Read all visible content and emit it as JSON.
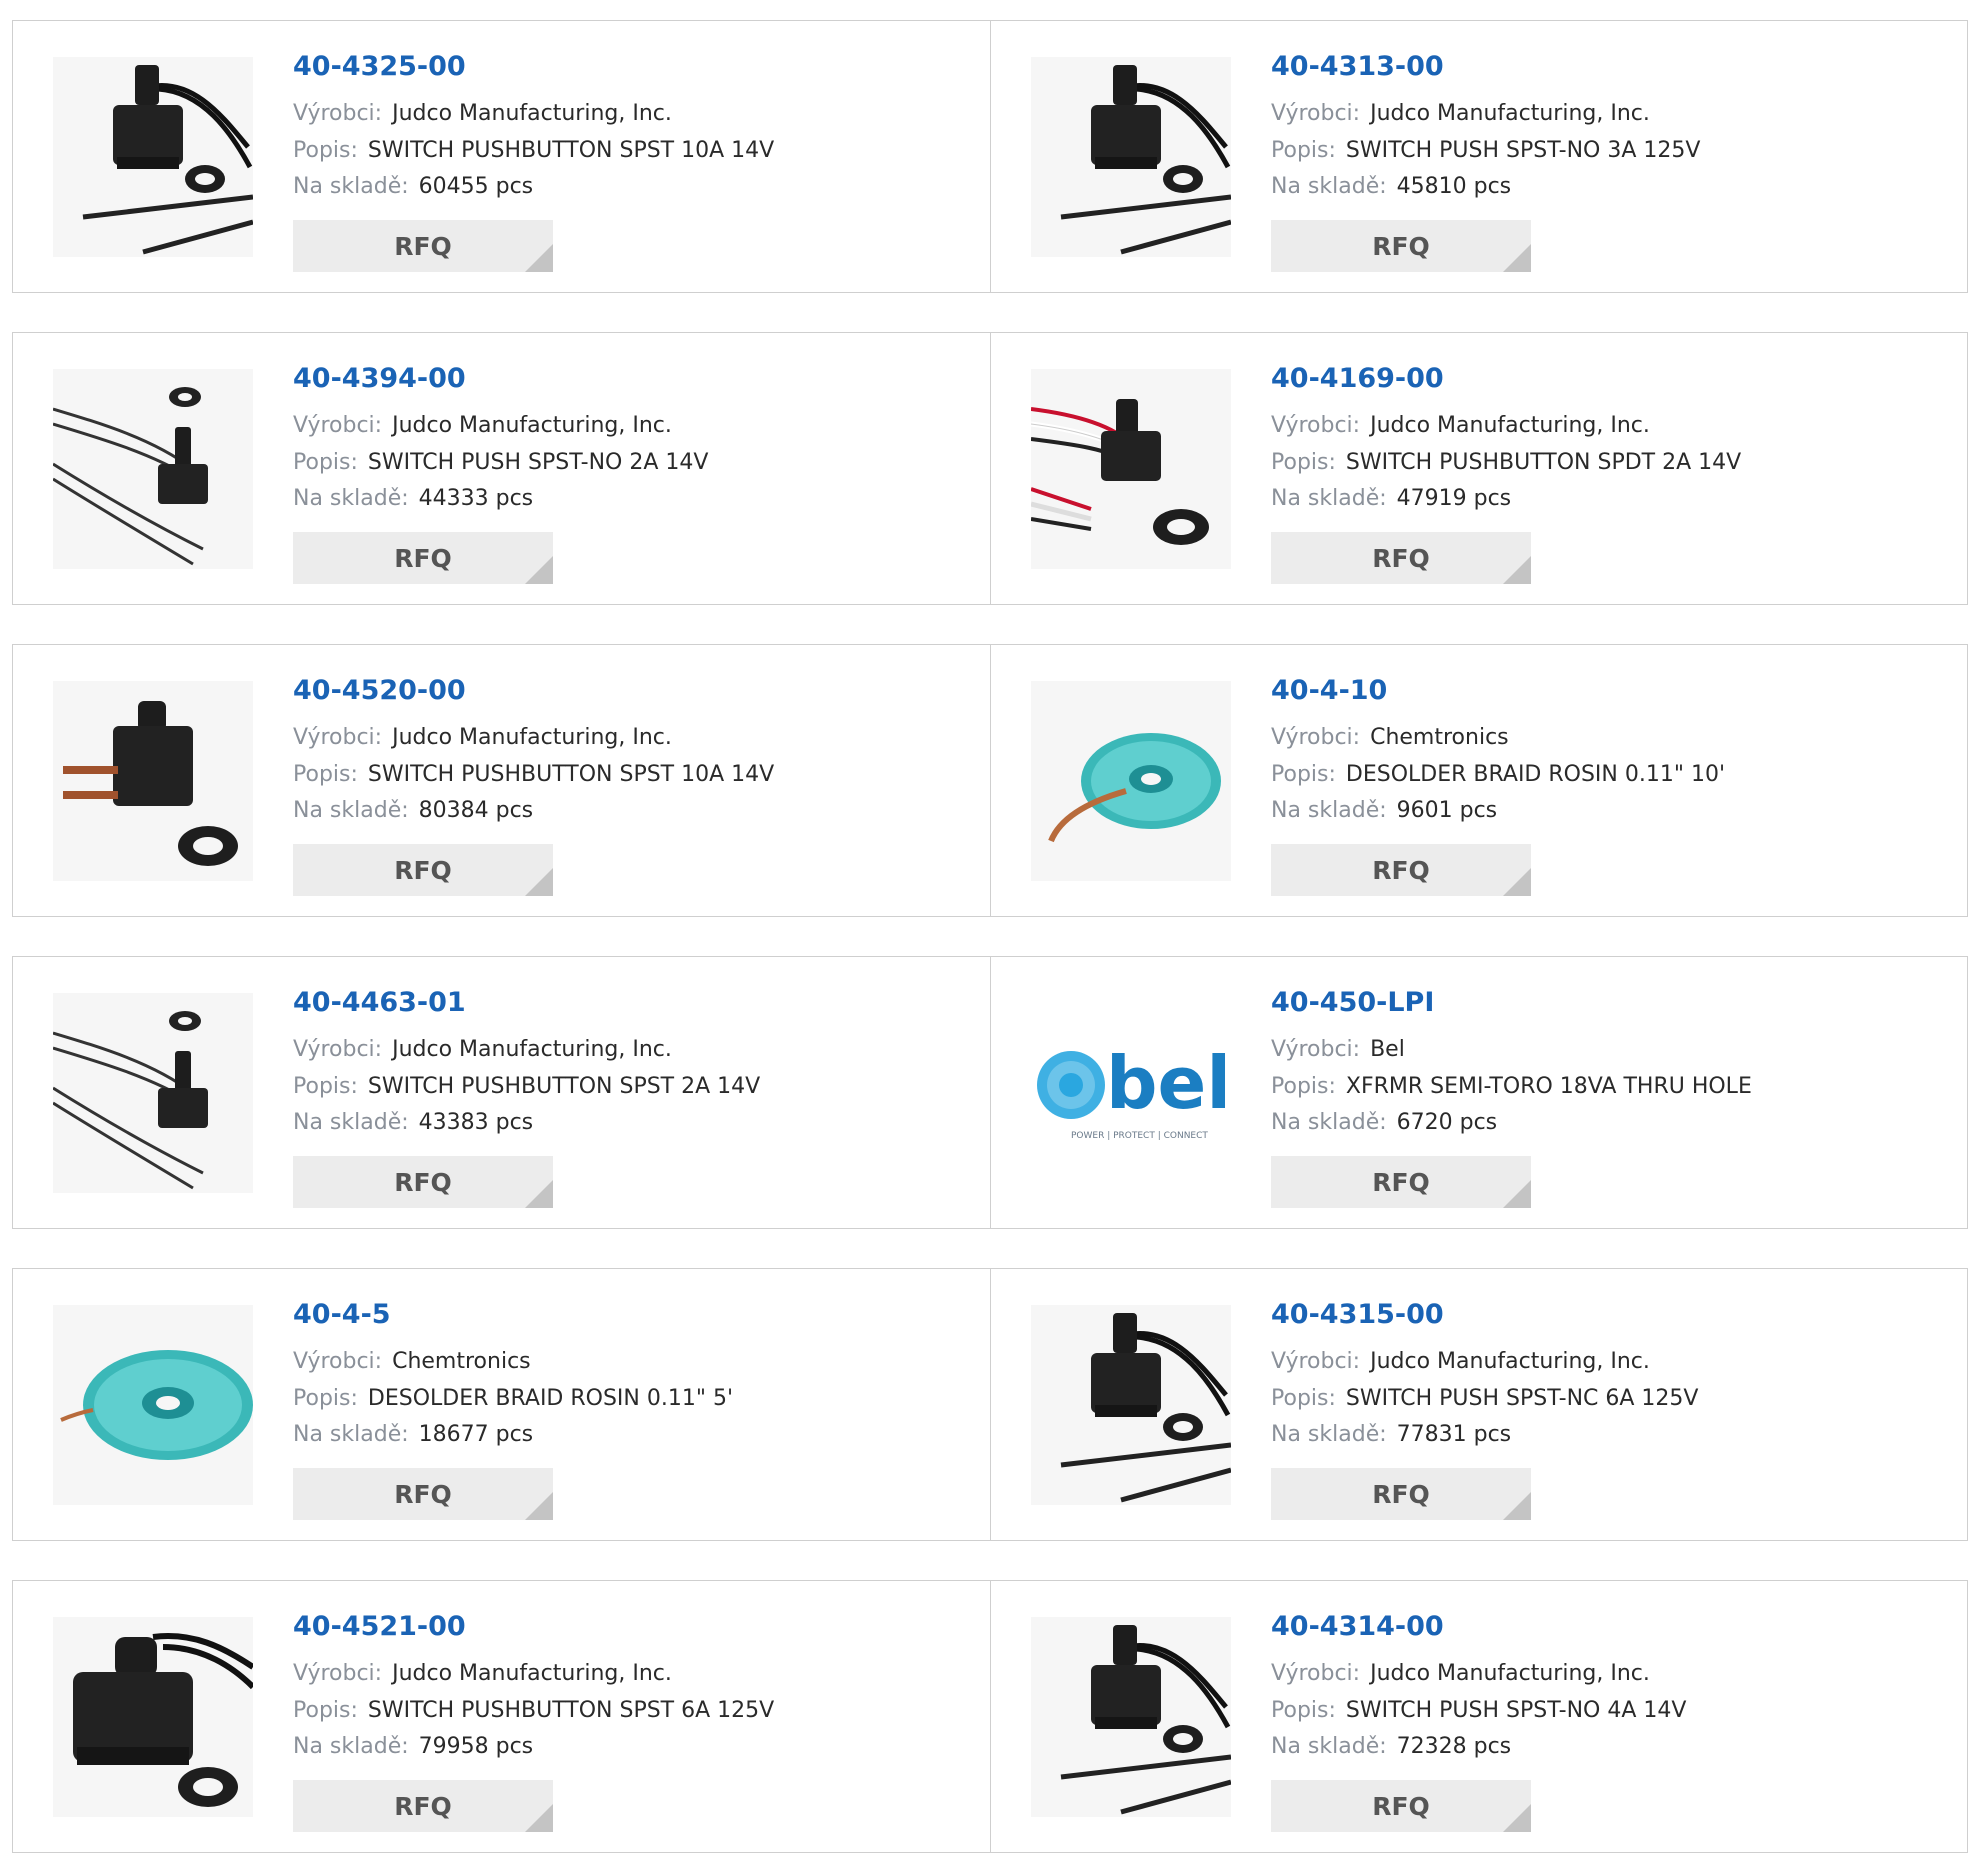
{
  "labels": {
    "manufacturer": "Výrobci:",
    "description": "Popis:",
    "stock": "Na skladě:",
    "rfq": "RFQ"
  },
  "colors": {
    "title": "#1a63b5",
    "label": "#8a9099",
    "rfq_bg": "#ececec",
    "border": "#cfcfcf"
  },
  "products": [
    {
      "part": "40-4325-00",
      "manufacturer": "Judco Manufacturing, Inc.",
      "description": "SWITCH PUSHBUTTON SPST 10A 14V",
      "stock": "60455 pcs",
      "image": "pushbutton-switch-wired"
    },
    {
      "part": "40-4313-00",
      "manufacturer": "Judco Manufacturing, Inc.",
      "description": "SWITCH PUSH SPST-NO 3A 125V",
      "stock": "45810 pcs",
      "image": "pushbutton-switch-wired"
    },
    {
      "part": "40-4394-00",
      "manufacturer": "Judco Manufacturing, Inc.",
      "description": "SWITCH PUSH SPST-NO 2A 14V",
      "stock": "44333 pcs",
      "image": "pushbutton-switch-small"
    },
    {
      "part": "40-4169-00",
      "manufacturer": "Judco Manufacturing, Inc.",
      "description": "SWITCH PUSHBUTTON SPDT 2A 14V",
      "stock": "47919 pcs",
      "image": "pushbutton-switch-colored-wires"
    },
    {
      "part": "40-4520-00",
      "manufacturer": "Judco Manufacturing, Inc.",
      "description": "SWITCH PUSHBUTTON SPST 10A 14V",
      "stock": "80384 pcs",
      "image": "pushbutton-switch-tabs"
    },
    {
      "part": "40-4-10",
      "manufacturer": "Chemtronics",
      "description": "DESOLDER BRAID ROSIN 0.11\" 10'",
      "stock": "9601 pcs",
      "image": "desolder-braid-spool"
    },
    {
      "part": "40-4463-01",
      "manufacturer": "Judco Manufacturing, Inc.",
      "description": "SWITCH PUSHBUTTON SPST 2A 14V",
      "stock": "43383 pcs",
      "image": "pushbutton-switch-small"
    },
    {
      "part": "40-450-LPI",
      "manufacturer": "Bel",
      "description": "XFRMR SEMI-TORO 18VA THRU HOLE",
      "stock": "6720 pcs",
      "image": "bel-logo"
    },
    {
      "part": "40-4-5",
      "manufacturer": "Chemtronics",
      "description": "DESOLDER BRAID ROSIN 0.11\" 5'",
      "stock": "18677 pcs",
      "image": "desolder-braid-spool"
    },
    {
      "part": "40-4315-00",
      "manufacturer": "Judco Manufacturing, Inc.",
      "description": "SWITCH PUSH SPST-NC 6A 125V",
      "stock": "77831 pcs",
      "image": "pushbutton-switch-wired"
    },
    {
      "part": "40-4521-00",
      "manufacturer": "Judco Manufacturing, Inc.",
      "description": "SWITCH PUSHBUTTON SPST 6A 125V",
      "stock": "79958 pcs",
      "image": "pushbutton-switch-large"
    },
    {
      "part": "40-4314-00",
      "manufacturer": "Judco Manufacturing, Inc.",
      "description": "SWITCH PUSH SPST-NO 4A 14V",
      "stock": "72328 pcs",
      "image": "pushbutton-switch-wired"
    }
  ],
  "bel_logo": {
    "wordmark": "bel",
    "tagline": "POWER | PROTECT | CONNECT"
  }
}
